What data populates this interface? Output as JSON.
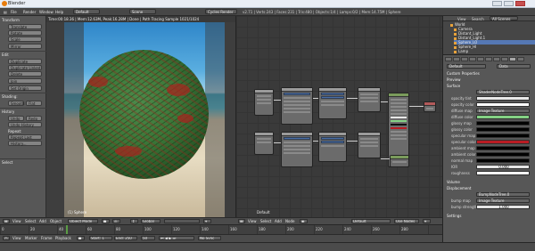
{
  "window": {
    "title": "Blender"
  },
  "menu": {
    "file": "File",
    "render": "Render",
    "window": "Window",
    "help": "Help",
    "layout": "Default",
    "scene": "Scene",
    "engine": "Cycles Render",
    "stats": "v2.71 | Verts:243 | Faces:231 | Tris:480 | Objects:1/4 | Lamps:0/2 | Mem:14.75M | Sphere"
  },
  "toolshelf": {
    "transform_header": "Transform",
    "translate": "Translate",
    "rotate": "Rotate",
    "scale": "Scale",
    "mirror": "Mirror",
    "edit_header": "Edit",
    "duplicate": "Duplicate",
    "duplicate_linked": "Duplicate Linked",
    "delete": "Delete",
    "join": "Join",
    "set_origin": "Set Origin",
    "shading_header": "Shading:",
    "smooth": "Smooth",
    "flat": "Flat",
    "history_header": "History",
    "undo": "Undo",
    "redo": "Redo",
    "undo_history": "Undo History",
    "repeat_header": "Repeat:",
    "repeat_last": "Repeat Last",
    "history": "History...",
    "select_header": "Select"
  },
  "viewport": {
    "info": "Time:00:18.36 | Mem:12.63M, Peak:16.28M | Done | Path Tracing Sample 1021/1024",
    "label": "(1) Sphere"
  },
  "node_editor": {
    "label": "Default"
  },
  "outliner": {
    "view": "View",
    "search": "Search",
    "all_scenes": "All Scenes",
    "rows": [
      "World",
      "Camera",
      "Distant_Light",
      "Distant_Light.1",
      "Sphere_LO",
      "Sphere_HI",
      "Lamp"
    ]
  },
  "properties": {
    "material_name": "Default",
    "data_label": "Data",
    "custom_props": "Custom Properties",
    "preview": "Preview",
    "surface": "Surface",
    "surface_shader": "ShaderNodeTree.0",
    "rows": [
      {
        "label": "opacity tint",
        "value": ""
      },
      {
        "label": "opacity color",
        "value": ""
      },
      {
        "label": "diffuse map",
        "value": "Image Texture"
      },
      {
        "label": "diffuse color",
        "value": ""
      },
      {
        "label": "glossy map",
        "value": ""
      },
      {
        "label": "glossy color",
        "value": ""
      },
      {
        "label": "specular map",
        "value": ""
      },
      {
        "label": "specular color",
        "value": ""
      },
      {
        "label": "ambient map",
        "value": ""
      },
      {
        "label": "ambient color",
        "value": ""
      },
      {
        "label": "normal map",
        "value": ""
      },
      {
        "label": "IOR",
        "value": "0.000"
      },
      {
        "label": "roughness",
        "value": ""
      }
    ],
    "volume": "Volume",
    "displacement": "Displacement",
    "disp_node": "BumpNodeTree.0",
    "bump_map": "bump map",
    "bump_value": "Image Texture",
    "bump_strength": "bump strength",
    "bump_strength_value": "1.000",
    "settings": "Settings"
  },
  "viewport_header": {
    "view": "View",
    "select": "Select",
    "add": "Add",
    "object": "Object",
    "mode": "Object Mode",
    "pivot": "Global"
  },
  "node_header": {
    "view": "View",
    "select": "Select",
    "add": "Add",
    "node": "Node",
    "material": "Default",
    "use_nodes": "Use Nodes"
  },
  "timeline": {
    "ticks": [
      "0",
      "20",
      "40",
      "60",
      "80",
      "100",
      "120",
      "140",
      "160",
      "180",
      "200",
      "220",
      "240",
      "260",
      "280"
    ],
    "view": "View",
    "marker": "Marker",
    "frame": "Frame",
    "playback": "Playback",
    "start": "Start: 1",
    "end": "End: 250",
    "current": "50",
    "sync": "No Sync"
  },
  "colors": {
    "accent": "#e87d0d",
    "selection": "#5578b4",
    "diffuse": "#84d184",
    "specular": "#b81c24",
    "glossy": "#000000"
  }
}
